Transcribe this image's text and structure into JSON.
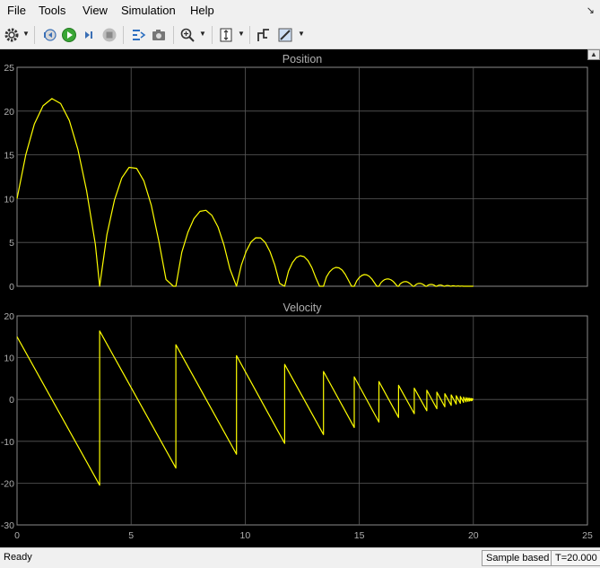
{
  "menu": [
    "File",
    "Tools",
    "View",
    "Simulation",
    "Help"
  ],
  "toolbar": {
    "icons": [
      "gear-icon",
      "step-back-icon",
      "run-icon",
      "step-forward-icon",
      "stop-icon",
      "highlight-icon",
      "camera-icon",
      "zoom-icon",
      "autoscale-icon",
      "signal-select-icon",
      "style-icon"
    ]
  },
  "colors": {
    "plot_bg": "#000000",
    "axes_bg": "#000000",
    "grid": "#5a5a5a",
    "axis_text": "#b0b0b0",
    "trace": "#ffff00"
  },
  "chart_data": [
    {
      "type": "line",
      "title": "Position",
      "xlim": [
        0,
        25
      ],
      "ylim": [
        0,
        25
      ],
      "xticks": [
        0,
        5,
        10,
        15,
        20,
        25
      ],
      "yticks": [
        0,
        5,
        10,
        15,
        20,
        25
      ],
      "grid": true,
      "series": [
        {
          "color": "#ffff00",
          "x": [
            0,
            0.38,
            0.76,
            1.14,
            1.53,
            1.91,
            2.29,
            2.67,
            3.05,
            3.43,
            3.62,
            3.62,
            3.94,
            4.27,
            4.59,
            4.91,
            5.24,
            5.56,
            5.88,
            6.21,
            6.53,
            6.85,
            6.96,
            6.96,
            7.22,
            7.49,
            7.75,
            8.02,
            8.28,
            8.54,
            8.81,
            9.07,
            9.33,
            9.62,
            9.62,
            9.83,
            10.04,
            10.25,
            10.46,
            10.67,
            10.88,
            11.09,
            11.3,
            11.51,
            11.73,
            11.73,
            11.9,
            12.07,
            12.24,
            12.41,
            12.58,
            12.75,
            12.92,
            13.09,
            13.26,
            13.43,
            13.43,
            13.56,
            13.7,
            13.84,
            13.97,
            14.11,
            14.25,
            14.38,
            14.52,
            14.66,
            14.78,
            14.78,
            14.89,
            15.0,
            15.11,
            15.22,
            15.33,
            15.44,
            15.55,
            15.66,
            15.77,
            15.86,
            15.86,
            15.95,
            16.04,
            16.13,
            16.22,
            16.31,
            16.4,
            16.49,
            16.58,
            16.67,
            16.72,
            16.72,
            16.79,
            16.86,
            16.93,
            17.0,
            17.07,
            17.14,
            17.21,
            17.28,
            17.35,
            17.41,
            17.41,
            17.47,
            17.52,
            17.58,
            17.63,
            17.69,
            17.74,
            17.8,
            17.85,
            17.91,
            17.96,
            17.96,
            18.0,
            18.05,
            18.09,
            18.14,
            18.18,
            18.22,
            18.27,
            18.31,
            18.35,
            18.4,
            18.4,
            18.43,
            18.47,
            18.5,
            18.54,
            18.57,
            18.61,
            18.64,
            18.68,
            18.71,
            18.75,
            18.75,
            18.78,
            18.8,
            18.83,
            18.86,
            18.89,
            18.92,
            18.94,
            18.97,
            19.0,
            19.03,
            19.03,
            19.05,
            19.07,
            19.09,
            19.12,
            19.14,
            19.16,
            19.18,
            19.21,
            19.23,
            19.25,
            19.25,
            19.27,
            19.29,
            19.3,
            19.32,
            19.34,
            19.36,
            19.38,
            19.39,
            19.41,
            19.43,
            19.43,
            19.44,
            19.46,
            19.47,
            19.49,
            19.5,
            19.51,
            19.53,
            19.54,
            19.56,
            19.57,
            19.57,
            19.68,
            19.8,
            19.92,
            20.0
          ],
          "y": [
            10,
            14.99,
            18.51,
            20.6,
            21.42,
            20.86,
            18.92,
            15.6,
            10.88,
            4.79,
            0,
            0,
            5.89,
            9.83,
            12.37,
            13.58,
            13.46,
            12.03,
            9.28,
            5.21,
            0.78,
            0,
            0,
            0,
            3.87,
            6.16,
            7.72,
            8.56,
            8.68,
            8.08,
            6.76,
            4.71,
            1.96,
            0,
            0,
            2.42,
            3.97,
            5.04,
            5.53,
            5.52,
            4.99,
            3.94,
            2.39,
            0.33,
            0,
            0,
            1.73,
            2.7,
            3.27,
            3.48,
            3.38,
            2.93,
            2.13,
            1.0,
            0,
            0,
            0,
            1.07,
            1.65,
            2.0,
            2.15,
            2.1,
            1.84,
            1.38,
            0.71,
            0,
            0,
            0,
            0.63,
            0.99,
            1.23,
            1.33,
            1.29,
            1.13,
            0.83,
            0.41,
            0,
            0,
            0,
            0.41,
            0.64,
            0.78,
            0.84,
            0.82,
            0.72,
            0.54,
            0.28,
            0,
            0,
            0,
            0.26,
            0.4,
            0.49,
            0.53,
            0.52,
            0.45,
            0.33,
            0.17,
            0,
            0,
            0,
            0.16,
            0.25,
            0.31,
            0.33,
            0.32,
            0.28,
            0.21,
            0.11,
            0,
            0,
            0,
            0.1,
            0.16,
            0.19,
            0.21,
            0.2,
            0.18,
            0.13,
            0.07,
            0,
            0,
            0,
            0.06,
            0.1,
            0.12,
            0.13,
            0.13,
            0.11,
            0.08,
            0.04,
            0,
            0,
            0,
            0.04,
            0.06,
            0.08,
            0.08,
            0.08,
            0.07,
            0.05,
            0.03,
            0,
            0,
            0,
            0.025,
            0.04,
            0.05,
            0.05,
            0.05,
            0.045,
            0.03,
            0.017,
            0,
            0,
            0,
            0.016,
            0.025,
            0.03,
            0.033,
            0.032,
            0.028,
            0.021,
            0.011,
            0,
            0,
            0,
            0.01,
            0.016,
            0.019,
            0.021,
            0.02,
            0.018,
            0.013,
            0.007,
            0,
            0,
            0,
            0,
            0,
            0,
            0
          ]
        }
      ]
    },
    {
      "type": "line",
      "title": "Velocity",
      "xlim": [
        0,
        25
      ],
      "ylim": [
        -30,
        20
      ],
      "xticks": [
        0,
        5,
        10,
        15,
        20,
        25
      ],
      "yticks": [
        -30,
        -20,
        -10,
        0,
        10,
        20
      ],
      "grid": true,
      "series": [
        {
          "color": "#ffff00",
          "x": [
            0,
            3.62,
            3.62,
            6.96,
            6.96,
            9.62,
            9.62,
            11.73,
            11.73,
            13.43,
            13.43,
            14.78,
            14.78,
            15.86,
            15.86,
            16.72,
            16.72,
            17.41,
            17.41,
            17.96,
            17.96,
            18.4,
            18.4,
            18.75,
            18.75,
            19.03,
            19.03,
            19.25,
            19.25,
            19.43,
            19.43,
            19.57,
            19.57,
            19.68,
            19.68,
            19.77,
            19.77,
            19.84,
            19.84,
            19.9,
            19.9,
            19.95,
            19.95,
            20.0
          ],
          "y": [
            15,
            -20.5,
            16.4,
            -16.4,
            13.1,
            -13.1,
            10.5,
            -10.5,
            8.4,
            -8.4,
            6.7,
            -6.7,
            5.4,
            -5.4,
            4.3,
            -4.3,
            3.4,
            -3.4,
            2.7,
            -2.7,
            2.2,
            -2.2,
            1.75,
            -1.75,
            1.4,
            -1.4,
            1.1,
            -1.1,
            0.9,
            -0.9,
            0.7,
            -0.7,
            0.56,
            -0.56,
            0.45,
            -0.45,
            0.36,
            -0.36,
            0.29,
            -0.29,
            0.23,
            -0.23,
            0.18,
            0
          ]
        }
      ]
    }
  ],
  "status": {
    "left": "Ready",
    "mode": "Sample based",
    "time": "T=20.000"
  }
}
